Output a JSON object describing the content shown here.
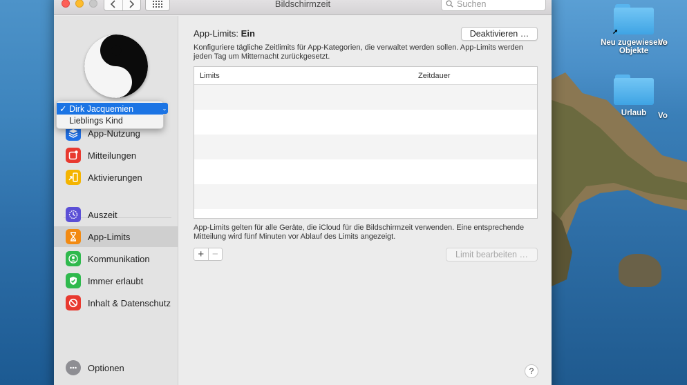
{
  "window": {
    "title": "Bildschirmzeit",
    "search_placeholder": "Suchen"
  },
  "user_menu": {
    "items": [
      {
        "label": "Dirk Jacquemien",
        "selected": true,
        "check": "✓"
      },
      {
        "label": "Lieblings Kind",
        "selected": false,
        "check": ""
      }
    ]
  },
  "sidebar": {
    "items": [
      {
        "label": "App-Nutzung",
        "icon": "layers-icon",
        "color": "#1f6fe5"
      },
      {
        "label": "Mitteilungen",
        "icon": "notification-icon",
        "color": "#e8392f"
      },
      {
        "label": "Aktivierungen",
        "icon": "pickup-icon",
        "color": "#f4b400"
      },
      {
        "label": "Auszeit",
        "icon": "downtime-icon",
        "color": "#5b4fd6"
      },
      {
        "label": "App-Limits",
        "icon": "hourglass-icon",
        "color": "#f28a12",
        "active": true
      },
      {
        "label": "Kommunikation",
        "icon": "contact-icon",
        "color": "#2fb94d"
      },
      {
        "label": "Immer erlaubt",
        "icon": "checkmark-shield-icon",
        "color": "#2fb94d"
      },
      {
        "label": "Inhalt & Datenschutz",
        "icon": "restriction-icon",
        "color": "#e8392f"
      }
    ],
    "options_label": "Optionen"
  },
  "main": {
    "header_label": "App-Limits:",
    "header_status": "Ein",
    "deactivate_button": "Deaktivieren …",
    "description": "Konfiguriere tägliche Zeitlimits für App-Kategorien, die verwaltet werden sollen. App-Limits werden jeden Tag um Mitternacht zurückgesetzt.",
    "table": {
      "columns": [
        "Limits",
        "Zeitdauer"
      ],
      "rows": []
    },
    "note": "App-Limits gelten für alle Geräte, die iCloud für die Bildschirmzeit verwenden. Eine entsprechende Mitteilung wird fünf Minuten vor Ablauf des Limits angezeigt.",
    "add_symbol": "+",
    "remove_symbol": "−",
    "edit_button": "Limit bearbeiten …",
    "help_symbol": "?"
  },
  "desktop": {
    "icons": [
      {
        "label": "Neu zugewiesene Objekte",
        "icon": "folder-icon"
      },
      {
        "label": "Urlaub",
        "icon": "folder-icon"
      },
      {
        "label": "Vo",
        "icon": "folder-icon"
      },
      {
        "label": "Vo",
        "icon": "folder-icon"
      }
    ]
  }
}
